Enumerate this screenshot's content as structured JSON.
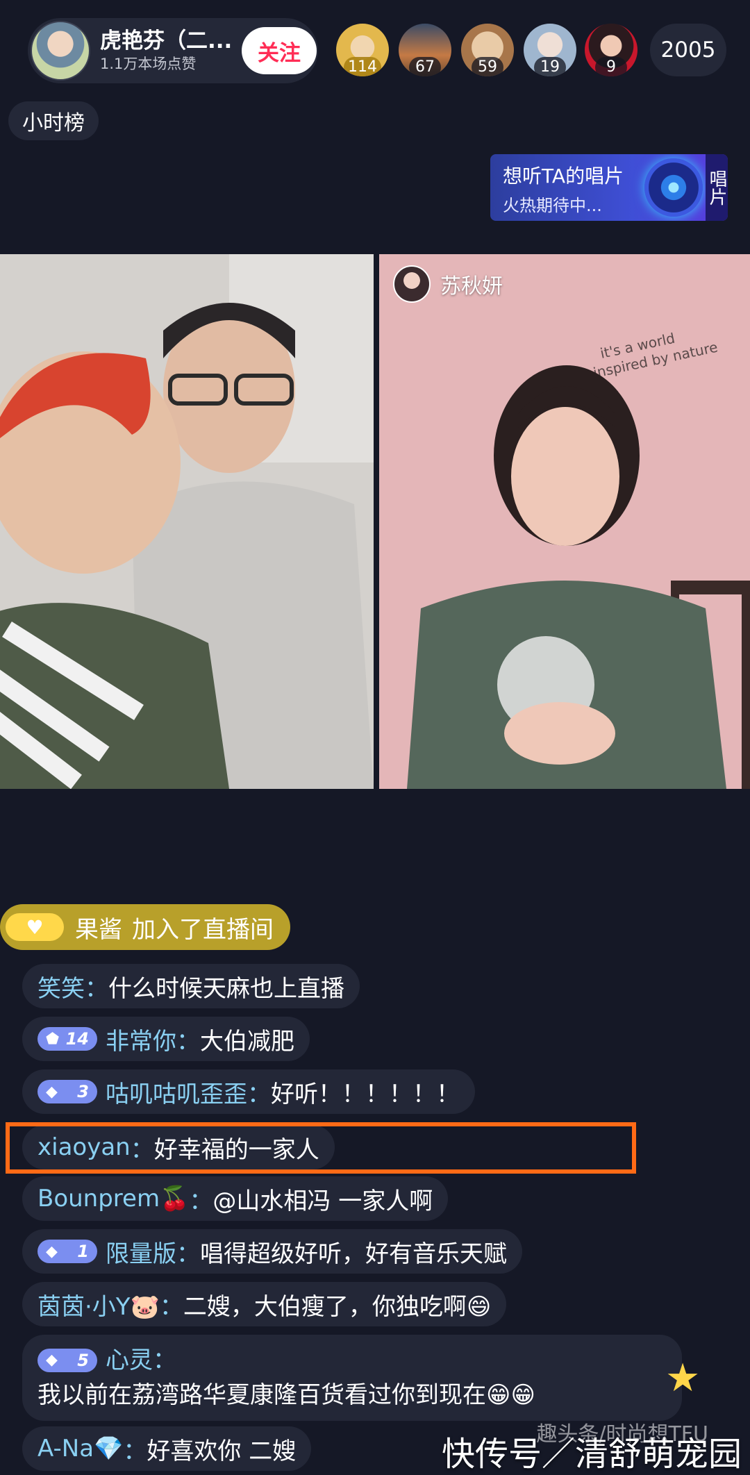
{
  "host": {
    "name": "虎艳芬（二...",
    "likes": "1.1万本场点赞",
    "follow_label": "关注"
  },
  "viewers": [
    {
      "badge": "114"
    },
    {
      "badge": "67"
    },
    {
      "badge": "59"
    },
    {
      "badge": "19"
    },
    {
      "badge": "9"
    }
  ],
  "viewer_count": "2005",
  "hour_rank_label": "小时榜",
  "record_banner": {
    "title": "想听TA的唱片",
    "subtitle": "火热期待中...",
    "side_label": "唱片"
  },
  "guest": {
    "name": "苏秋妍"
  },
  "join_notice": {
    "user": "果酱",
    "text": "加入了直播间",
    "badge_icon": "heart-icon"
  },
  "comments": [
    {
      "user": "笑笑",
      "sep": "：",
      "text": "什么时候天麻也上直播",
      "level": null
    },
    {
      "user": "非常你",
      "sep": "：",
      "text": "大伯减肥",
      "level": "14"
    },
    {
      "user": "咕叽咕叽歪歪",
      "sep": "：",
      "text": "好听！！！！！！",
      "level": "3"
    },
    {
      "user": "xiaoyan",
      "sep": "：",
      "text": "好幸福的一家人",
      "level": null
    },
    {
      "user": "Bounprem🍒",
      "sep": "：",
      "text": "@山水相冯 一家人啊",
      "level": null
    },
    {
      "user": "限量版",
      "sep": "：",
      "text": "唱得超级好听，好有音乐天赋",
      "level": "1"
    },
    {
      "user": "茵茵·小Y🐷",
      "sep": "：",
      "text": "二嫂，大伯瘦了，你独吃啊😄",
      "level": null
    },
    {
      "user": "心灵",
      "sep": "：",
      "text": "我以前在荔湾路华夏康隆百货看过你到现在😁😁",
      "level": "5"
    },
    {
      "user": "A-Na💎",
      "sep": "：",
      "text": "好喜欢你 二嫂",
      "level": null
    }
  ],
  "watermark": "快传号／清舒萌宠园",
  "watermark_small": "趣头条/时尚想TFU",
  "colors": {
    "background": "#151826",
    "username": "#8ad0f2",
    "follow": "#ff2d55",
    "highlight": "#ff6a16",
    "join_notice": "#b8a02a"
  }
}
